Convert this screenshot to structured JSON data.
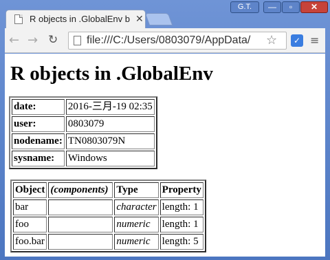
{
  "window": {
    "user_label": "G.T.",
    "min_glyph": "—",
    "max_glyph": "▫",
    "close_glyph": "✕"
  },
  "tab": {
    "title": "R objects in .GlobalEnv b",
    "close_glyph": "✕"
  },
  "toolbar": {
    "back_glyph": "←",
    "forward_glyph": "→",
    "reload_glyph": "↻",
    "url": "file:///C:/Users/0803079/AppData/",
    "star_glyph": "☆",
    "extension_glyph": "✓",
    "menu_glyph": "≡"
  },
  "page": {
    "heading": "R objects in .GlobalEnv",
    "info": [
      {
        "key": "date:",
        "value": "2016-三月-19 02:35"
      },
      {
        "key": "user:",
        "value": "0803079"
      },
      {
        "key": "nodename:",
        "value": "TN0803079N"
      },
      {
        "key": "sysname:",
        "value": "Windows"
      }
    ],
    "objects": {
      "headers": [
        "Object",
        "(components)",
        "Type",
        "Property"
      ],
      "rows": [
        {
          "object": "bar",
          "components": "",
          "type": "character",
          "property": "length: 1"
        },
        {
          "object": "foo",
          "components": "",
          "type": "numeric",
          "property": "length: 1"
        },
        {
          "object": "foo.bar",
          "components": "",
          "type": "numeric",
          "property": "length: 5"
        }
      ]
    }
  }
}
